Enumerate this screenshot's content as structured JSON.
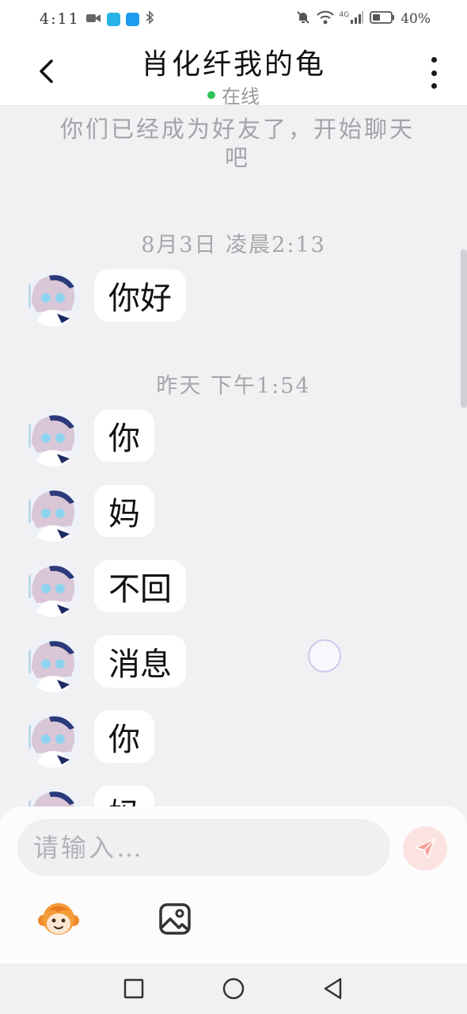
{
  "status_bar": {
    "time": "4:11",
    "network": "4G",
    "battery": "40%"
  },
  "header": {
    "title": "肖化纤我的龟",
    "status": "在线",
    "colors": {
      "online": "#2fc35a"
    }
  },
  "chat": {
    "system_message": "你们已经成为好友了，开始聊天吧",
    "groups": [
      {
        "timestamp": "8月3日  凌晨2:13",
        "messages": [
          "你好"
        ]
      },
      {
        "timestamp": "昨天  下午1:54",
        "messages": [
          "你",
          "妈",
          "不回",
          "消息",
          "你",
          "妈"
        ]
      }
    ]
  },
  "composer": {
    "placeholder": "请输入…",
    "icons": [
      "send-icon",
      "emoji-monkey-icon",
      "image-icon"
    ],
    "colors": {
      "send": "#f7a09a"
    }
  },
  "nav_bar": {
    "icons": [
      "recent-apps-icon",
      "home-icon",
      "back-icon"
    ]
  }
}
